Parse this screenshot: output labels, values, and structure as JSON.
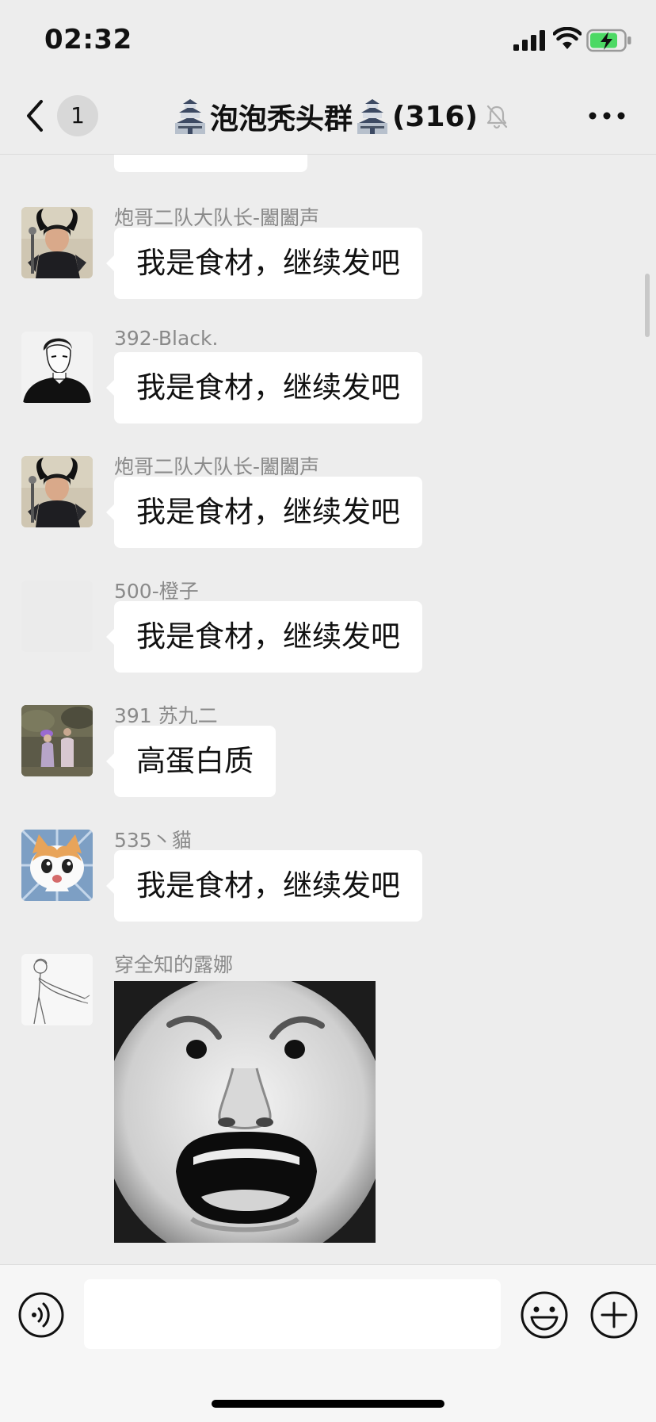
{
  "status_bar": {
    "time": "02:32"
  },
  "nav_bar": {
    "unread_count": "1",
    "title": "泡泡秃头群",
    "member_count": "(316)"
  },
  "messages": [
    {
      "sender": "炮哥二队大队长-闔闔声",
      "text": "我是食材，继续发吧",
      "avatar": "horned-girl-avatar"
    },
    {
      "sender": "392-Black.",
      "text": "我是食材，继续发吧",
      "avatar": "sketch-man-avatar"
    },
    {
      "sender": "炮哥二队大队长-闔闔声",
      "text": "我是食材，继续发吧",
      "avatar": "horned-girl-avatar"
    },
    {
      "sender": "500-橙子",
      "text": "我是食材，继续发吧",
      "avatar": "blank-avatar"
    },
    {
      "sender": "391 苏九二",
      "text": "高蛋白质",
      "avatar": "couple-photo-avatar"
    },
    {
      "sender": "535丶貓",
      "text": "我是食材，继续发吧",
      "avatar": "cartoon-cat-avatar"
    },
    {
      "sender": "穿全知的露娜",
      "sticker": "shocked-face-meme",
      "avatar": "line-drawing-avatar"
    }
  ],
  "input_bar": {
    "input_value": "",
    "icons": [
      "voice-icon",
      "emoji-icon",
      "plus-icon"
    ]
  },
  "colors": {
    "background": "#ededed",
    "bubble": "#ffffff",
    "sender_text": "#8a8a8a",
    "input_bar": "#f6f6f6"
  }
}
